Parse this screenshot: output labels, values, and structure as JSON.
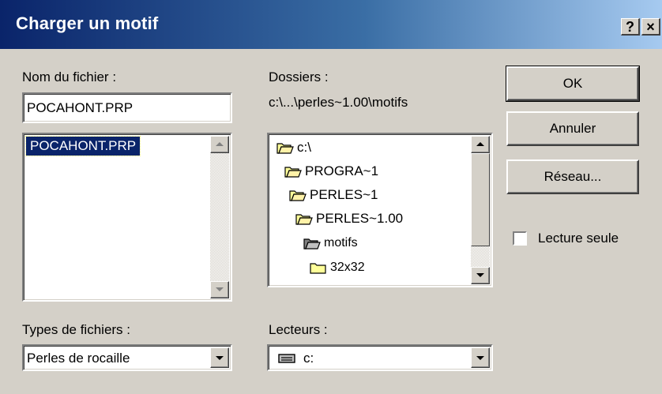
{
  "window": {
    "title": "Charger un motif",
    "help_label": "?",
    "close_label": "×"
  },
  "file_name": {
    "label": "Nom du fichier :",
    "value": "POCAHONT.PRP"
  },
  "file_list": {
    "items": [
      "POCAHONT.PRP"
    ],
    "selected": "POCAHONT.PRP"
  },
  "folders": {
    "label": "Dossiers :",
    "current_path": "c:\\...\\perles~1.00\\motifs",
    "tree": [
      {
        "name": "c:\\",
        "icon": "open-folder-icon"
      },
      {
        "name": "PROGRA~1",
        "icon": "open-folder-icon"
      },
      {
        "name": "PERLES~1",
        "icon": "open-folder-icon"
      },
      {
        "name": "PERLES~1.00",
        "icon": "open-folder-icon"
      },
      {
        "name": "motifs",
        "icon": "open-folder-icon"
      },
      {
        "name": "32x32",
        "icon": "closed-folder-icon"
      }
    ]
  },
  "file_types": {
    "label": "Types de fichiers :",
    "value": "Perles de rocaille"
  },
  "drives": {
    "label": "Lecteurs :",
    "value": "c:",
    "icon": "drive-icon"
  },
  "buttons": {
    "ok": "OK",
    "cancel": "Annuler",
    "network": "Réseau..."
  },
  "read_only": {
    "label": "Lecture seule",
    "checked": false
  },
  "colors": {
    "title_start": "#0a246a",
    "title_end": "#a6caf0",
    "selection": "#0a246a",
    "face": "#d4d0c8"
  }
}
